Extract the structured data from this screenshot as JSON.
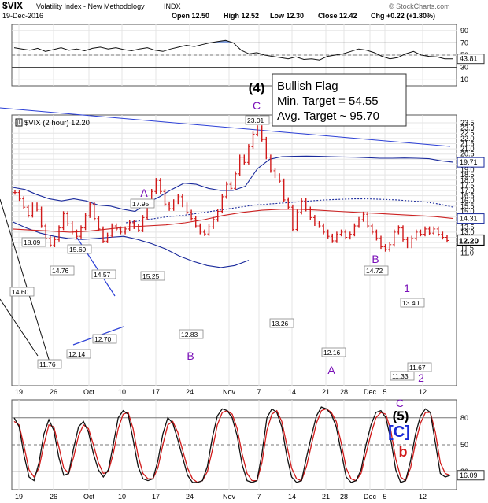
{
  "header": {
    "symbol": "$VIX",
    "name": "Volatility Index - New Methodology",
    "exchange": "INDX",
    "date": "19-Dec-2016",
    "ohlc": [
      {
        "label": "Open",
        "value": "12.50"
      },
      {
        "label": "High",
        "value": "12.52"
      },
      {
        "label": "Low",
        "value": "12.30"
      },
      {
        "label": "Close",
        "value": "12.42"
      },
      {
        "label": "Chg",
        "value": "+0.22 (+1.80%)"
      }
    ],
    "watermark": "© StockCharts.com"
  },
  "colors": {
    "price": "#d11a1a",
    "ma": "#cc2222",
    "band": "#1a2a9c",
    "trend": "#2b3fd6",
    "wave": "#7a10b8",
    "rsi_fill": "#7f9bd6",
    "stoch_k": "#111111",
    "stoch_d": "#d11a1a",
    "grid": "#e5e5e5"
  },
  "chart_data": [
    {
      "type": "line",
      "panel": "rsi",
      "ylim": [
        0,
        100
      ],
      "y_ticks": [
        "90",
        "70",
        "50",
        "30",
        "10"
      ],
      "last_value": "43.81",
      "reference_levels": [
        30,
        70
      ],
      "values": [
        62,
        60,
        58,
        61,
        56,
        59,
        62,
        58,
        60,
        57,
        61,
        63,
        60,
        62,
        59,
        57,
        60,
        62,
        58,
        56,
        60,
        63,
        66,
        64,
        67,
        70,
        72,
        74,
        70,
        58,
        52,
        54,
        50,
        48,
        46,
        44,
        47,
        43,
        44,
        42,
        48,
        50,
        52,
        56,
        60,
        58,
        54,
        48,
        44,
        46,
        52,
        56,
        50,
        48,
        47,
        44,
        44
      ]
    },
    {
      "type": "line",
      "panel": "price",
      "title": "$VIX (2 hour) 12.20",
      "x_ticks": [
        "19",
        "26",
        "Oct",
        "10",
        "17",
        "24",
        "Nov",
        "7",
        "14",
        "21",
        "28",
        "Dec",
        "5",
        "12"
      ],
      "y_ticks": [
        "23.5",
        "23.0",
        "22.5",
        "22.0",
        "21.5",
        "21.0",
        "20.5",
        "20.0",
        "19.5",
        "19.0",
        "18.5",
        "18.0",
        "17.5",
        "17.0",
        "16.5",
        "16.0",
        "15.5",
        "15.0",
        "14.5",
        "14.0",
        "13.5",
        "13.0",
        "12.5",
        "12.0",
        "11.5",
        "11.0"
      ],
      "last_price": "12.20",
      "right_tags": [
        {
          "label": "19.71",
          "value": 19.71
        },
        {
          "label": "14.31",
          "value": 14.31
        }
      ],
      "values": [
        16.8,
        16.2,
        15.4,
        14.6,
        15.6,
        15.2,
        13.6,
        12.4,
        11.76,
        12.3,
        13.4,
        14.76,
        13.8,
        13.0,
        12.6,
        13.4,
        14.57,
        15.69,
        14.3,
        13.3,
        12.14,
        12.7,
        13.6,
        13.3,
        13.0,
        13.3,
        13.9,
        13.5,
        13.2,
        14.4,
        15.8,
        16.9,
        17.95,
        16.9,
        15.7,
        15.25,
        15.9,
        16.4,
        15.6,
        14.9,
        14.3,
        13.6,
        13.0,
        12.83,
        13.5,
        14.2,
        15.0,
        16.4,
        17.6,
        17.2,
        18.6,
        20.2,
        19.7,
        21.2,
        22.4,
        23.01,
        21.9,
        20.2,
        18.9,
        18.4,
        17.9,
        16.1,
        15.4,
        13.26,
        14.9,
        16.0,
        15.2,
        14.4,
        13.8,
        13.6,
        13.0,
        12.6,
        12.16,
        12.8,
        13.0,
        12.5,
        12.8,
        13.6,
        14.2,
        14.72,
        13.6,
        13.0,
        12.4,
        11.6,
        11.33,
        11.8,
        13.0,
        13.4,
        12.3,
        11.67,
        12.4,
        13.0,
        12.8,
        13.3,
        12.9,
        13.3,
        12.8,
        12.5,
        12.2
      ],
      "upper_band": [
        17.3,
        17.1,
        16.6,
        16.2,
        16.0,
        16.2,
        16.0,
        15.6,
        15.5,
        15.2,
        15.0,
        15.8,
        16.4,
        17.1,
        17.7,
        17.6,
        17.2,
        17.0,
        17.0,
        17.4,
        19.1,
        20.0,
        20.25,
        20.28,
        20.3,
        20.28,
        20.25,
        20.22,
        20.2,
        20.15,
        20.1,
        20.1,
        20.12,
        20.1,
        20.05,
        19.85,
        19.71
      ],
      "lower_band": [
        14.0,
        13.4,
        12.9,
        12.6,
        12.4,
        12.3,
        12.4,
        12.5,
        12.6,
        12.3,
        11.9,
        11.4,
        10.7,
        10.2,
        9.8,
        9.6,
        9.8,
        10.3
      ],
      "moving_avg": [
        13.3,
        13.2,
        13.1,
        13.0,
        13.1,
        13.3,
        13.5,
        13.6,
        13.7,
        13.9,
        14.2,
        14.6,
        14.9,
        15.1,
        15.2,
        15.2,
        15.1,
        15.0,
        14.9,
        14.8,
        14.7,
        14.6,
        14.5,
        14.31
      ],
      "dotted_avg": [
        13.9,
        14.1,
        14.3,
        14.5,
        14.6,
        14.8,
        15.0,
        15.2,
        15.4,
        15.6,
        15.7,
        15.8,
        15.9,
        16.0,
        16.1,
        16.15,
        16.2,
        16.2,
        16.15,
        16.1,
        16.0,
        15.9,
        15.7,
        15.4
      ],
      "price_labels": [
        "18.09",
        "14.60",
        "11.76",
        "14.76",
        "15.69",
        "14.57",
        "12.14",
        "12.70",
        "17.95",
        "15.25",
        "12.83",
        "23.01",
        "13.26",
        "12.16",
        "14.72",
        "13.40",
        "11.33",
        "11.67"
      ],
      "wave_labels": [
        {
          "text": "A",
          "kind": "wave"
        },
        {
          "text": "B",
          "kind": "wave"
        },
        {
          "text": "(4)",
          "kind": "major"
        },
        {
          "text": "C",
          "kind": "wave"
        },
        {
          "text": "A",
          "kind": "wave"
        },
        {
          "text": "B",
          "kind": "wave"
        },
        {
          "text": "1",
          "kind": "wave"
        },
        {
          "text": "2",
          "kind": "wave"
        }
      ],
      "annotation": {
        "lines": [
          "Bullish Flag",
          "Min. Target = 54.55",
          "Avg. Target ~ 95.70"
        ]
      }
    },
    {
      "type": "line",
      "panel": "stochastic",
      "ylim": [
        0,
        100
      ],
      "y_ticks": [
        "80",
        "50",
        "20"
      ],
      "last_value": "16.09",
      "wave_labels": [
        {
          "text": "C",
          "kind": "wave"
        },
        {
          "text": "(5)",
          "kind": "major"
        },
        {
          "text": "[C]",
          "kind": "bracket"
        },
        {
          "text": "b",
          "kind": "red"
        }
      ],
      "k": [
        80,
        70,
        38,
        14,
        10,
        30,
        62,
        78,
        66,
        36,
        16,
        18,
        46,
        70,
        76,
        64,
        40,
        22,
        14,
        22,
        50,
        80,
        88,
        84,
        56,
        26,
        12,
        10,
        12,
        32,
        62,
        80,
        74,
        56,
        36,
        16,
        8,
        8,
        10,
        26,
        58,
        82,
        90,
        88,
        80,
        60,
        28,
        10,
        8,
        10,
        40,
        80,
        90,
        86,
        70,
        38,
        14,
        8,
        10,
        36,
        60,
        82,
        92,
        90,
        84,
        70,
        42,
        14,
        8,
        10,
        22,
        50,
        72,
        86,
        88,
        80,
        56,
        22,
        8,
        10,
        32,
        62,
        82,
        90,
        86,
        52,
        18,
        14,
        16
      ],
      "d": [
        76,
        72,
        48,
        22,
        14,
        24,
        50,
        72,
        70,
        48,
        24,
        18,
        36,
        60,
        72,
        68,
        50,
        30,
        18,
        20,
        40,
        68,
        84,
        86,
        68,
        38,
        18,
        12,
        12,
        24,
        50,
        72,
        76,
        64,
        44,
        24,
        12,
        8,
        10,
        20,
        44,
        72,
        86,
        88,
        84,
        68,
        40,
        18,
        10,
        10,
        30,
        66,
        84,
        88,
        76,
        50,
        24,
        12,
        10,
        26,
        50,
        74,
        88,
        90,
        86,
        76,
        52,
        24,
        12,
        10,
        18,
        40,
        62,
        80,
        86,
        84,
        66,
        34,
        14,
        10,
        24,
        52,
        74,
        86,
        86,
        64,
        30,
        18,
        16
      ]
    }
  ]
}
